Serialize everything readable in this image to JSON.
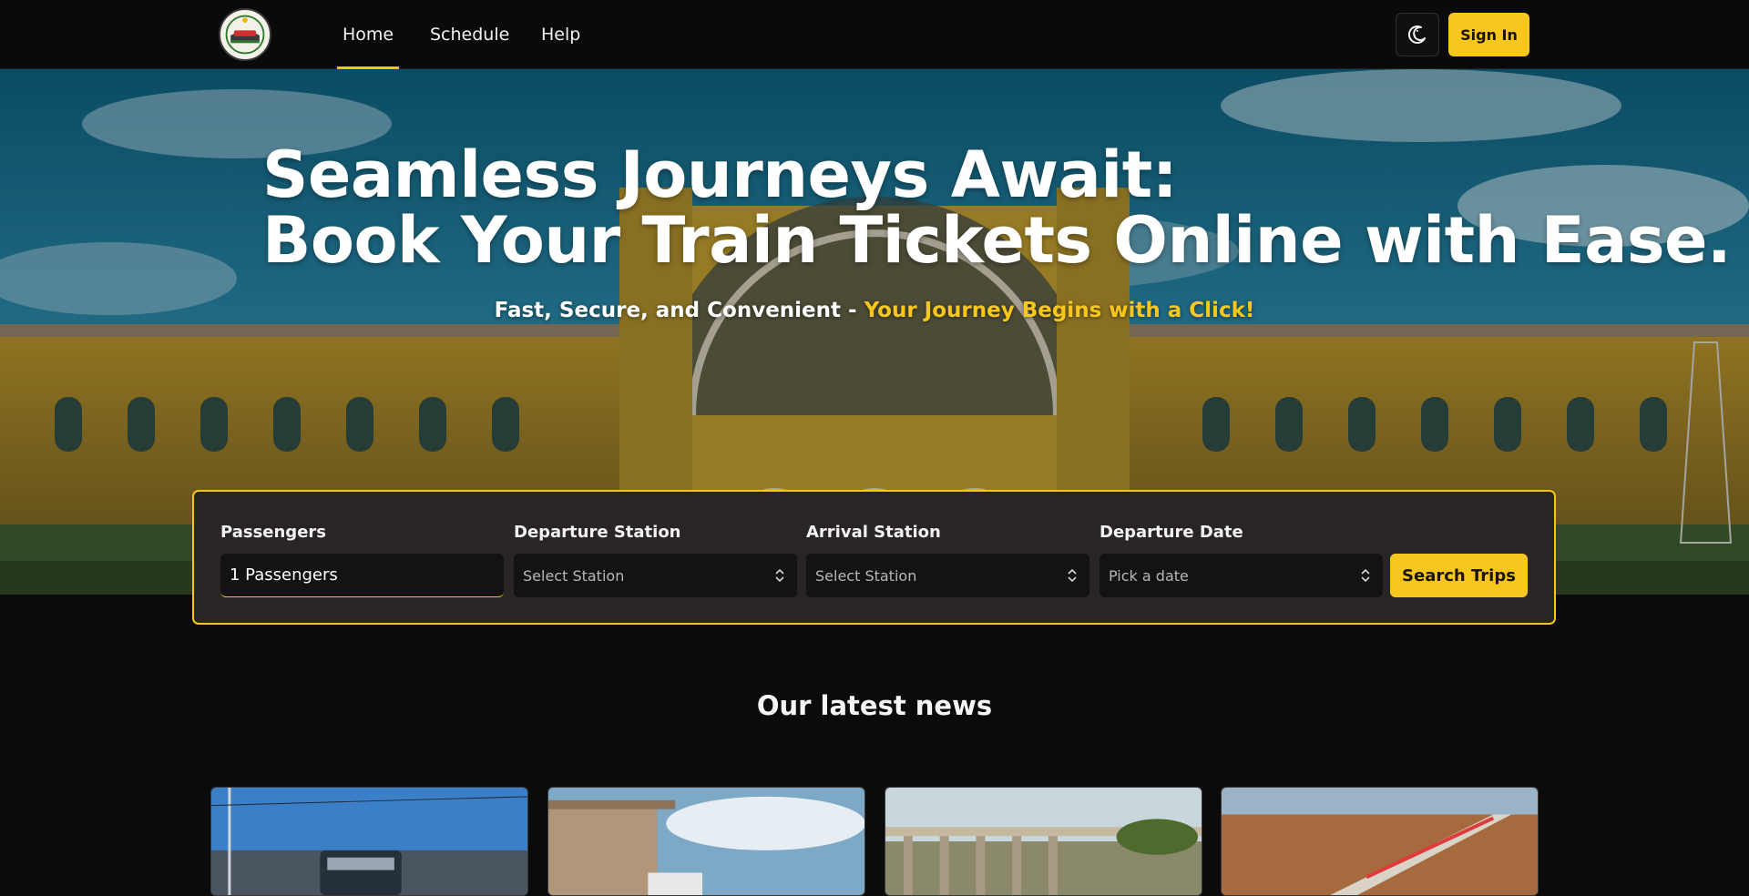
{
  "nav": {
    "links": [
      "Home",
      "Schedule",
      "Help"
    ],
    "active": "Home",
    "theme_toggle_icon": "moon-icon",
    "sign_in_label": "Sign In"
  },
  "hero": {
    "title_line1": "Seamless Journeys Await:",
    "title_line2": "Book Your Train Tickets Online with Ease.",
    "subtitle_plain": "Fast, Secure, and Convenient - ",
    "subtitle_highlight": "Your Journey Begins with a Click!"
  },
  "search": {
    "passengers_label": "Passengers",
    "passengers_value": "1 Passengers",
    "departure_label": "Departure Station",
    "departure_placeholder": "Select Station",
    "arrival_label": "Arrival Station",
    "arrival_placeholder": "Select Station",
    "date_label": "Departure Date",
    "date_placeholder": "Pick a date",
    "search_button_label": "Search Trips"
  },
  "news": {
    "title": "Our latest news",
    "cards": [
      {
        "image": "electric-locomotive-photo"
      },
      {
        "image": "station-platform-photo"
      },
      {
        "image": "railway-viaduct-photo"
      },
      {
        "image": "train-on-bridge-photo"
      }
    ]
  },
  "colors": {
    "accent": "#f8c71d",
    "background": "#0c0b0b",
    "card": "#292525",
    "field": "#141212"
  }
}
